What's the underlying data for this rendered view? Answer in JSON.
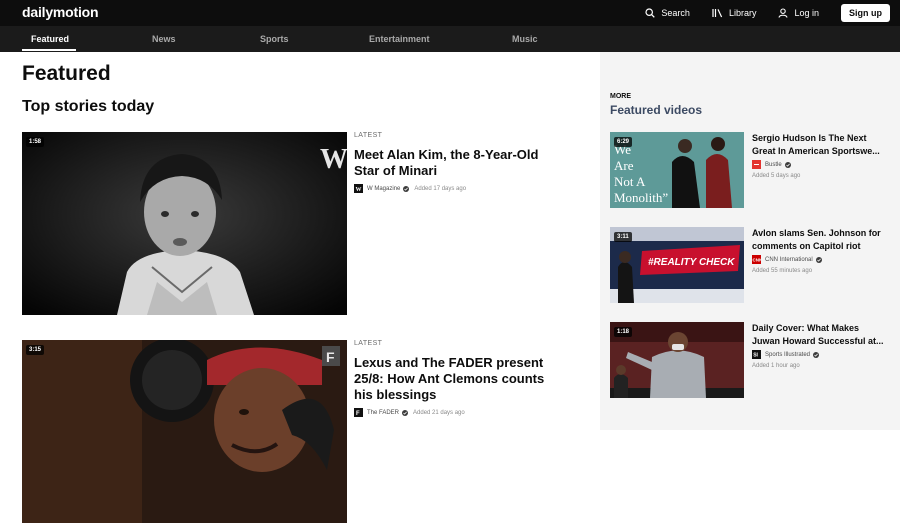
{
  "header": {
    "logo": "dailymotion",
    "search_label": "Search",
    "library_label": "Library",
    "login_label": "Log in",
    "signup_label": "Sign up"
  },
  "nav": {
    "items": [
      {
        "label": "Featured",
        "active": true
      },
      {
        "label": "News"
      },
      {
        "label": "Sports"
      },
      {
        "label": "Entertainment"
      },
      {
        "label": "Music"
      }
    ]
  },
  "main": {
    "title": "Featured",
    "section_title": "Top stories today",
    "stories": [
      {
        "duration": "1:58",
        "kicker": "LATEST",
        "title_lines": [
          "Meet Alan Kim, the 8-Year-Old",
          "Star of Minari"
        ],
        "channel": "W Magazine",
        "added": "Added 17 days ago",
        "thumb_badge": "W"
      },
      {
        "duration": "3:15",
        "kicker": "LATEST",
        "title_lines": [
          "Lexus and The FADER present",
          "25/8: How Ant Clemons counts",
          "his blessings"
        ],
        "channel": "The FADER",
        "added": "Added 21 days ago",
        "thumb_badge": "F"
      }
    ]
  },
  "sidebar": {
    "more": "MORE",
    "title": "Featured videos",
    "videos": [
      {
        "duration": "6:29",
        "title_lines": [
          "Sergio Hudson Is The Next",
          "Great In American Sportswe..."
        ],
        "channel": "Bustle",
        "added": "Added 5 days ago",
        "thumb_text": "We Are Not A Monolith”"
      },
      {
        "duration": "3:11",
        "title_lines": [
          "Avlon slams Sen. Johnson for",
          "comments on Capitol riot"
        ],
        "channel": "CNN International",
        "added": "Added 55 minutes ago",
        "thumb_text": "#REALITY CHECK"
      },
      {
        "duration": "1:18",
        "title_lines": [
          "Daily Cover: What Makes",
          "Juwan Howard Successful at..."
        ],
        "channel": "Sports Illustrated",
        "added": "Added 1 hour ago",
        "thumb_text": ""
      }
    ]
  }
}
